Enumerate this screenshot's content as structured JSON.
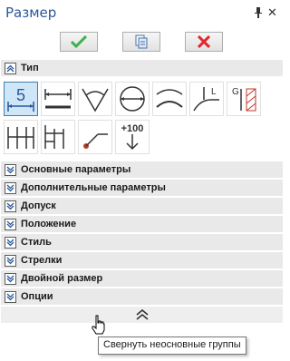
{
  "window": {
    "title": "Размер"
  },
  "tools": [
    {
      "icon": "dimension-value-icon",
      "text": "5",
      "selected": true
    },
    {
      "icon": "linear-dimension-icon"
    },
    {
      "icon": "angular-dimension-icon"
    },
    {
      "icon": "diameter-dimension-icon"
    },
    {
      "icon": "arc-dimension-icon"
    },
    {
      "icon": "leader-dimension-icon"
    },
    {
      "icon": "hatch-dimension-icon"
    },
    {
      "icon": "chain-dimension-icon"
    },
    {
      "icon": "baseline-dimension-icon"
    },
    {
      "icon": "point-leader-icon"
    },
    {
      "icon": "level-mark-icon",
      "text": "+100"
    }
  ],
  "groups": [
    {
      "label": "Тип",
      "expanded": true
    },
    {
      "label": "Основные параметры",
      "expanded": false
    },
    {
      "label": "Дополнительные параметры",
      "expanded": false
    },
    {
      "label": "Допуск",
      "expanded": false
    },
    {
      "label": "Положение",
      "expanded": false
    },
    {
      "label": "Стиль",
      "expanded": false
    },
    {
      "label": "Стрелки",
      "expanded": false
    },
    {
      "label": "Двойной размер",
      "expanded": false
    },
    {
      "label": "Опции",
      "expanded": false
    }
  ],
  "tooltip": "Свернуть неосновные группы",
  "colors": {
    "title": "#2b579a",
    "ok": "#3cb34a",
    "cancel": "#e0282e",
    "selected": "#cfe6f8"
  }
}
